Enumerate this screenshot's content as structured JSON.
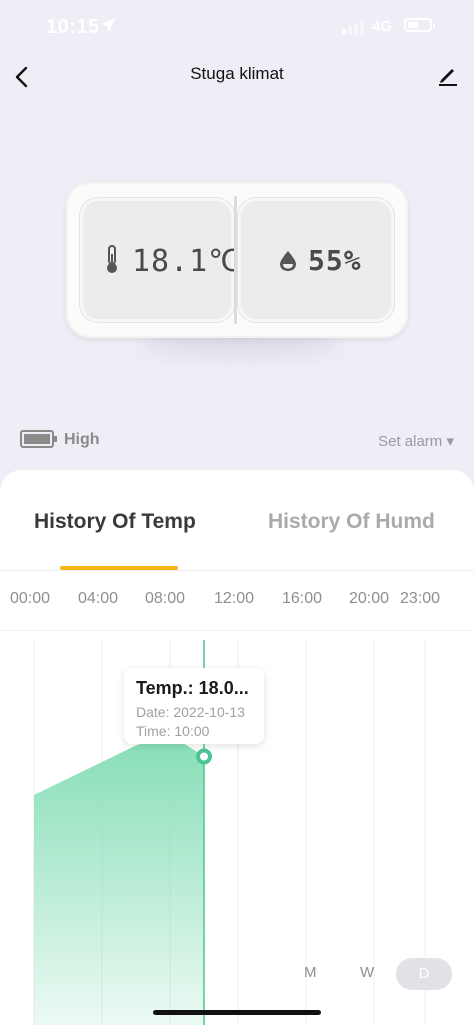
{
  "status_bar": {
    "time": "10:15",
    "network": "4G"
  },
  "nav": {
    "title": "Stuga klimat",
    "back_icon": "chevron-left-icon",
    "edit_icon": "pencil-icon"
  },
  "device": {
    "temperature": "18.1℃",
    "humidity": "55%",
    "temp_icon": "thermometer-icon",
    "humidity_icon": "droplet-icon"
  },
  "battery": {
    "label": "High",
    "icon": "battery-icon"
  },
  "alarm": {
    "label": "Set alarm ▾"
  },
  "tabs": {
    "temp": "History Of Temp",
    "humd": "History Of Humd",
    "active": "temp"
  },
  "colors": {
    "accent": "#f4b41a",
    "chart_fill": "#7fdcb2",
    "chart_line": "#4cc594"
  },
  "chart_data": {
    "type": "area",
    "x_ticks": [
      "00:00",
      "04:00",
      "08:00",
      "12:00",
      "16:00",
      "20:00",
      "23:00"
    ],
    "x": [
      "00:00",
      "02:00",
      "04:00",
      "06:00",
      "08:00",
      "09:00",
      "10:00"
    ],
    "values": [
      17.3,
      17.6,
      17.9,
      18.2,
      18.4,
      18.2,
      18.0
    ],
    "grid": true,
    "tooltip": {
      "title": "Temp.: 18.0...",
      "date": "Date: 2022-10-13",
      "time": "Time: 10:00"
    }
  },
  "range": {
    "month": "M",
    "week": "W",
    "day": "D",
    "selected": "D"
  }
}
